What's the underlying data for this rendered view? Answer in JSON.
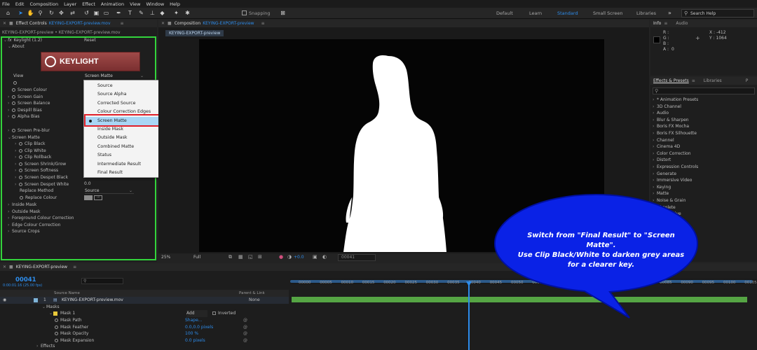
{
  "menu": [
    "File",
    "Edit",
    "Composition",
    "Layer",
    "Effect",
    "Animation",
    "View",
    "Window",
    "Help"
  ],
  "toolbar": {
    "snapping": "Snapping",
    "workspaces": [
      "Default",
      "Learn",
      "Standard",
      "Small Screen",
      "Libraries"
    ],
    "active_workspace": "Standard",
    "search_placeholder": "Search Help"
  },
  "effect_controls": {
    "tab_label": "Effect Controls",
    "tab_file": "KEYING-EXPORT-preview.mov",
    "breadcrumb": "KEYING-EXPORT-preview • KEYING-EXPORT-preview.mov",
    "effect_name": "Keylight (1.2)",
    "reset": "Reset",
    "about": "About",
    "logo_text": "KEYLIGHT",
    "view_label": "View",
    "view_value": "Screen Matte",
    "rows": [
      "Screen Colour",
      "Screen Gain",
      "Screen Balance",
      "Despill Bias",
      "Alpha Bias"
    ],
    "pre_blur": "Screen Pre-blur",
    "screen_matte": "Screen Matte",
    "matte_rows": [
      "Clip Black",
      "Clip White",
      "Clip Rollback",
      "Screen Shrink/Grow",
      "Screen Softness",
      "Screen Despot Black",
      "Screen Despot White"
    ],
    "despot_white_value": "0.0",
    "replace_method_label": "Replace Method",
    "replace_method_value": "Source",
    "replace_colour": "Replace Colour",
    "groups": [
      "Inside Mask",
      "Outside Mask",
      "Foreground Colour Correction",
      "Edge Colour Correction",
      "Source Crops"
    ]
  },
  "view_dropdown": {
    "items": [
      "Source",
      "Source Alpha",
      "Corrected Source",
      "Colour Correction Edges",
      "Screen Matte",
      "Inside Mask",
      "Outside Mask",
      "Combined Matte",
      "Status",
      "Intermediate Result",
      "Final Result"
    ],
    "selected_index": 4
  },
  "composition": {
    "tab_label": "Composition",
    "tab_name": "KEYING-EXPORT-preview",
    "sub_tab": "KEYING-EXPORT-preview",
    "zoom": "25%",
    "resolution": "Full",
    "exposure": "+0.0",
    "timecode": "00041"
  },
  "info": {
    "tab_info": "Info",
    "tab_audio": "Audio",
    "r": "R :",
    "g": "G :",
    "b": "B :",
    "a": "A :",
    "a_value": "0",
    "x": "X : -412",
    "y": "Y : 1064"
  },
  "effects_presets": {
    "tab": "Effects & Presets",
    "libraries": "Libraries",
    "p": "P",
    "items": [
      "* Animation Presets",
      "3D Channel",
      "Audio",
      "Blur & Sharpen",
      "Boris FX Mocha",
      "Boris FX Silhouette",
      "Channel",
      "Cinema 4D",
      "Color Correction",
      "Distort",
      "Expression Controls",
      "Generate",
      "Immersive Video",
      "Keying",
      "Matte",
      "Noise & Grain",
      "Obsolete",
      "Perspective",
      "Plug-ins"
    ]
  },
  "timeline": {
    "tab": "KEYING-EXPORT-preview",
    "timecode": "00041",
    "sub_timecode": "0:00:01:16 (25.00 fps)",
    "col_source": "Source Name",
    "col_parent": "Parent & Link",
    "layer_num": "1",
    "layer_name": "KEYING-EXPORT-preview.mov",
    "parent": "None",
    "masks": "Masks",
    "mask1": "Mask 1",
    "mode": "Add",
    "inverted": "Inverted",
    "mask_props": [
      {
        "name": "Mask Path",
        "value": "Shape..."
      },
      {
        "name": "Mask Feather",
        "value": "0.0,0.0 pixels"
      },
      {
        "name": "Mask Opacity",
        "value": "100 %"
      },
      {
        "name": "Mask Expansion",
        "value": "0.0 pixels"
      }
    ],
    "effects": "Effects",
    "ruler": [
      "00000",
      "00005",
      "00010",
      "00015",
      "00020",
      "00025",
      "00030",
      "00035",
      "00040",
      "00045",
      "00050",
      "00055",
      "00060",
      "00065",
      "00070",
      "00075",
      "00080",
      "00085",
      "00090",
      "00095",
      "00100",
      "00105"
    ]
  },
  "callout": {
    "line1": "Switch from \"Final Result\" to \"Screen Matte\".",
    "line2": "Use Clip Black/White to darken grey areas",
    "line3": "for a clearer key."
  }
}
